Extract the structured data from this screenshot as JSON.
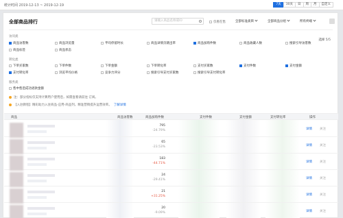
{
  "top": {
    "range_label": "统计时间 2019-12-13 ~ 2019-12-19",
    "periods": [
      "7天",
      "30天",
      "日",
      "周",
      "月",
      "自定义"
    ],
    "active_period": "7天"
  },
  "panel": {
    "title": "全部商品排行",
    "search_placeholder": "请输入商品名称或ID",
    "only_shelf_label": "仅看在售",
    "dropdowns": [
      "全部标准类目",
      "全部商品分组",
      "所有终端"
    ],
    "selected_count": "选择 5/5"
  },
  "sections": {
    "traffic": "访问类",
    "transaction": "转化类",
    "service": "服务类"
  },
  "checks_row1": [
    {
      "label": "商品访客数",
      "on": true
    },
    {
      "label": "商品浏览量",
      "on": false
    },
    {
      "label": "平均停留时长",
      "on": false
    },
    {
      "label": "商品详情页跳出率",
      "on": false
    },
    {
      "label": "商品加购件数",
      "on": true
    },
    {
      "label": "商品收藏人数",
      "on": false
    },
    {
      "label": "搜索引导访客数",
      "on": false
    }
  ],
  "checks_row1b": [
    {
      "label": "商品标签",
      "on": false
    },
    {
      "label": "商品状态",
      "on": false
    }
  ],
  "checks_row2": [
    {
      "label": "下单买家数",
      "on": false
    },
    {
      "label": "下单件数",
      "on": false
    },
    {
      "label": "下单金额",
      "on": false
    },
    {
      "label": "下单转化率",
      "on": false
    },
    {
      "label": "支付买家数",
      "on": false
    },
    {
      "label": "支付件数",
      "on": true
    },
    {
      "label": "支付金额",
      "on": true
    }
  ],
  "checks_row3": [
    {
      "label": "支付转化率",
      "on": true
    },
    {
      "label": "浏览平均价格",
      "on": false
    },
    {
      "label": "竞争力评分",
      "on": false
    },
    {
      "label": "搜索引导支付买家数",
      "on": false
    },
    {
      "label": "搜索引导支付转化率",
      "on": false
    }
  ],
  "checks_row4": [
    {
      "label": "售中售后成功退款金额",
      "on": false
    }
  ],
  "tips": [
    {
      "text": "注：部分指标仅支持计算用户使用后，如需查看请前往 订阅。",
      "link": ""
    },
    {
      "text": "【入驻教程】精彩助力入驻商品-应用-商品列，精准营销提升运营效率。",
      "link": "了解详情"
    }
  ],
  "columns": [
    "商品",
    "商品访客数",
    "商品加购件数",
    "支付件数",
    "支付金额",
    "支付转化率",
    "操作"
  ],
  "rows": [
    {
      "num": "795",
      "pct": "-24.79%",
      "dir": "down"
    },
    {
      "num": "65",
      "pct": "-23.53%",
      "dir": "down"
    },
    {
      "num": "183",
      "pct": "-44.71%",
      "dir": "up"
    },
    {
      "num": "24",
      "pct": "-29.41%",
      "dir": "down"
    },
    {
      "num": "21",
      "pct": "+31.25%",
      "dir": "up"
    },
    {
      "num": "20",
      "pct": "-9.09%",
      "dir": "down"
    }
  ],
  "row_actions": [
    "详情",
    "关注"
  ],
  "colors": {
    "accent": "#1e6fe0",
    "up": "#e5533d"
  }
}
